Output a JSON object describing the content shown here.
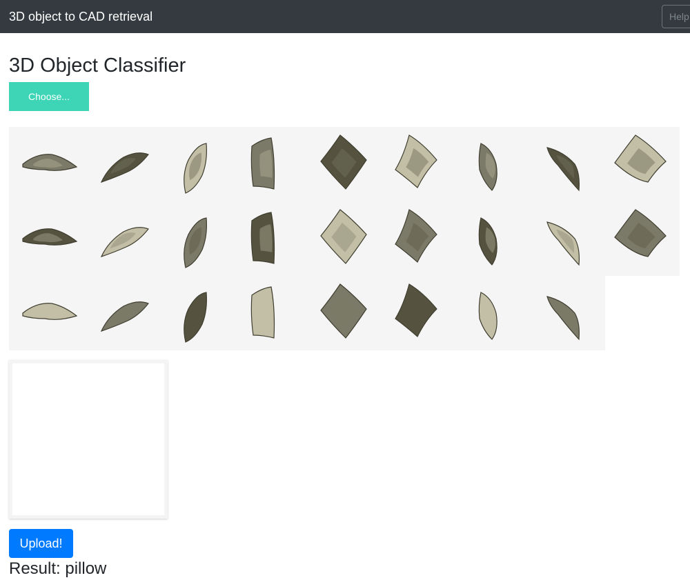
{
  "navbar": {
    "brand": "3D object to CAD retrieval",
    "help_placeholder": "Help"
  },
  "main": {
    "title": "3D Object Classifier",
    "choose_label": "Choose...",
    "upload_label": "Upload!",
    "result_text": "Result: pillow"
  },
  "gallery": {
    "rows": [
      9,
      9,
      8
    ],
    "colors": {
      "fabric": "#7b7a68",
      "dark": "#55533f",
      "light": "#c2bfa6",
      "background": "#f5f5f5"
    }
  },
  "colors": {
    "navbar_bg": "#343a40",
    "choose_button": "#3dd5b5",
    "upload_button": "#007bff"
  }
}
